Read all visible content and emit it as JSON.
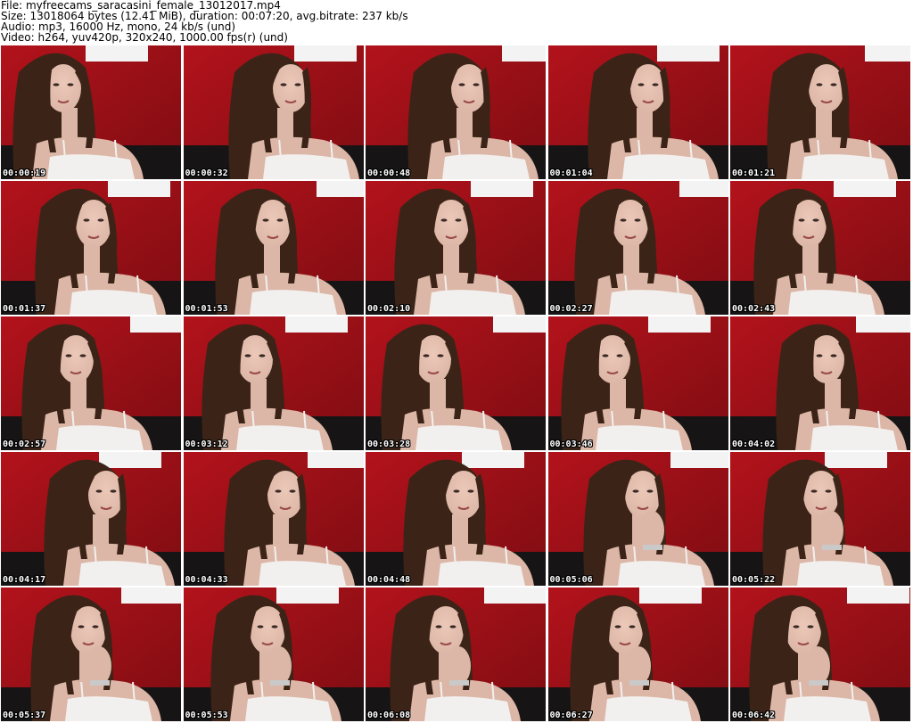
{
  "header": {
    "file": "File: myfreecams_saracasini_female_13012017.mp4",
    "size": "Size: 13018064 bytes (12.41 MiB), duration: 00:07:20, avg.bitrate: 237 kb/s",
    "audio": "Audio: mp3, 16000 Hz, mono, 24 kb/s (und)",
    "video": "Video: h264, yuv420p, 320x240, 1000.00 fps(r) (und)"
  },
  "colors": {
    "wall_red": "#b3121b",
    "wall_dark": "#7e0d12",
    "hair": "#3b2417",
    "skin": "#dcb6a6",
    "top": "#f2f0ee",
    "frame_white": "#f3f3f3",
    "couch": "#161414"
  },
  "thumbnails": [
    {
      "time": "00:00:19"
    },
    {
      "time": "00:00:32"
    },
    {
      "time": "00:00:48"
    },
    {
      "time": "00:01:04"
    },
    {
      "time": "00:01:21"
    },
    {
      "time": "00:01:37"
    },
    {
      "time": "00:01:53"
    },
    {
      "time": "00:02:10"
    },
    {
      "time": "00:02:27"
    },
    {
      "time": "00:02:43"
    },
    {
      "time": "00:02:57"
    },
    {
      "time": "00:03:12"
    },
    {
      "time": "00:03:28"
    },
    {
      "time": "00:03:46"
    },
    {
      "time": "00:04:02"
    },
    {
      "time": "00:04:17"
    },
    {
      "time": "00:04:33"
    },
    {
      "time": "00:04:48"
    },
    {
      "time": "00:05:06"
    },
    {
      "time": "00:05:22"
    },
    {
      "time": "00:05:37"
    },
    {
      "time": "00:05:53"
    },
    {
      "time": "00:06:08"
    },
    {
      "time": "00:06:27"
    },
    {
      "time": "00:06:42"
    }
  ]
}
